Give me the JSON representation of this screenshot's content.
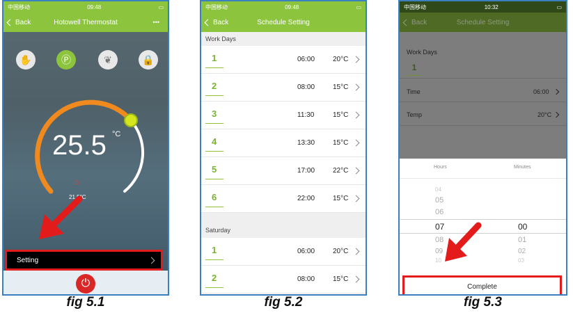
{
  "phone1": {
    "status_carrier": "中国移动",
    "status_time": "09:48",
    "nav_back": "Back",
    "nav_title": "Hotowell Thermostat",
    "nav_more": "•••",
    "temperature": "25.5",
    "temperature_unit": "°C",
    "current_temp": "21.5°C",
    "setting_label": "Setting"
  },
  "phone2": {
    "status_carrier": "中国移动",
    "status_time": "09:48",
    "nav_back": "Back",
    "nav_title": "Schedule Setting",
    "work_days_label": "Work Days",
    "saturday_label": "Saturday",
    "work_days": [
      {
        "period": "1",
        "time": "06:00",
        "temp": "20°C"
      },
      {
        "period": "2",
        "time": "08:00",
        "temp": "15°C"
      },
      {
        "period": "3",
        "time": "11:30",
        "temp": "15°C"
      },
      {
        "period": "4",
        "time": "13:30",
        "temp": "15°C"
      },
      {
        "period": "5",
        "time": "17:00",
        "temp": "22°C"
      },
      {
        "period": "6",
        "time": "22:00",
        "temp": "15°C"
      }
    ],
    "saturday": [
      {
        "period": "1",
        "time": "06:00",
        "temp": "20°C"
      },
      {
        "period": "2",
        "time": "08:00",
        "temp": "15°C"
      }
    ]
  },
  "phone3": {
    "status_carrier": "中国移动",
    "status_time": "10:32",
    "nav_back": "Back",
    "nav_title": "Schedule Setting",
    "work_days_label": "Work Days",
    "period": "1",
    "time_label": "Time",
    "time_value": "06:00",
    "temp_label": "Temp",
    "temp_value": "20°C",
    "hours_label": "Hours",
    "minutes_label": "Minutes",
    "hours": [
      "04",
      "05",
      "06",
      "07",
      "08",
      "09",
      "10"
    ],
    "minutes": [
      "00",
      "01",
      "02",
      "03"
    ],
    "complete_label": "Complete"
  },
  "captions": [
    "fig 5.1",
    "fig 5.2",
    "fig 5.3"
  ],
  "colors": {
    "brand_green": "#8cc43e",
    "highlight_red": "#e31b1b",
    "dial_orange": "#f08a1e"
  }
}
